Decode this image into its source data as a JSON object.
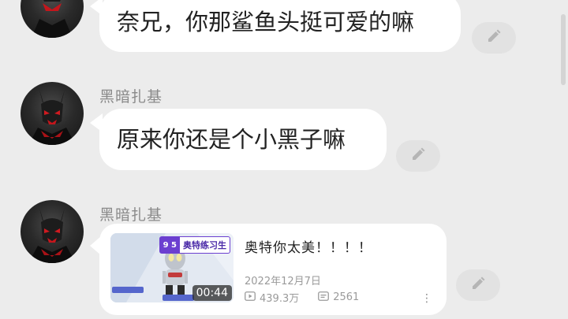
{
  "messages": [
    {
      "text": "奈兄，你那鲨鱼头挺可爱的嘛"
    },
    {
      "sender": "黑暗扎基",
      "text": "原来你还是个小黑子嘛"
    },
    {
      "sender": "黑暗扎基",
      "video": {
        "title": "奥特你太美！！！！",
        "date": "2022年12月7日",
        "views": "439.3万",
        "comments": "2561",
        "duration": "00:44",
        "thumbnail_tag_num": "9\n5",
        "thumbnail_tag_text": "奥特练习生"
      }
    }
  ],
  "icons": {
    "edit": "pencil-icon",
    "play": "play-icon",
    "comments": "comment-icon",
    "more": "more-dots-icon"
  },
  "colors": {
    "background": "#ececec",
    "bubble": "#ffffff",
    "sender_name": "#8a8a8a",
    "tag_accent": "#6b3fd0"
  }
}
